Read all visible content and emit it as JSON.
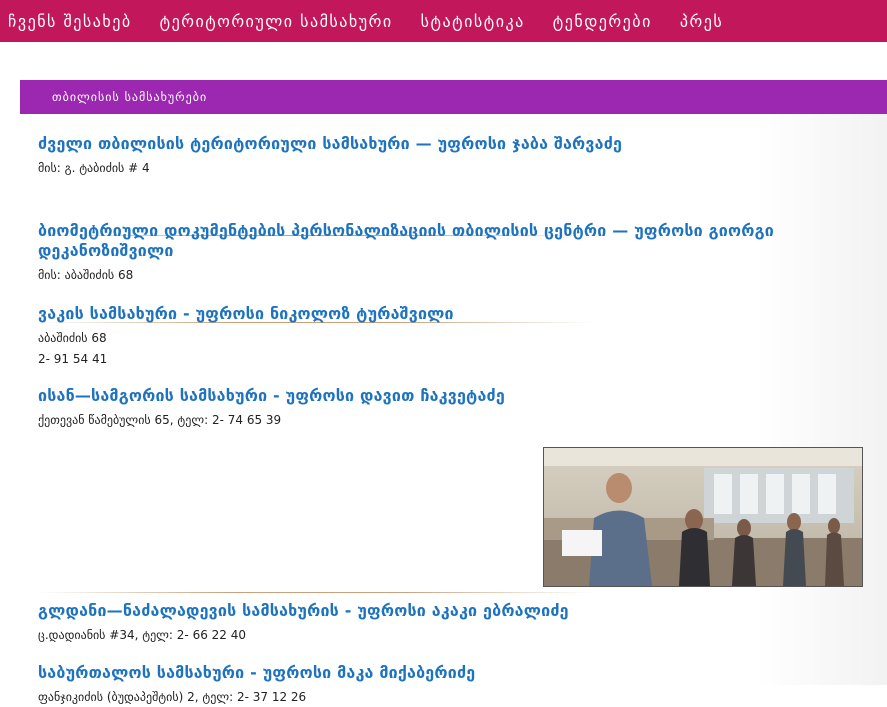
{
  "nav": {
    "items": [
      "ჩვენს შესახებ",
      "ტერიტორიული სამსახური",
      "სტატისტიკა",
      "ტენდერები",
      "პრეს"
    ]
  },
  "panel": {
    "heading": "თბილისის სამსახურები",
    "entries": [
      {
        "title": "ძველი თბილისის ტერიტორიული სამსახური — უფროსი ჯაბა შარვაძე",
        "lines": [
          "მის: გ. ტაბიძის # 4"
        ]
      },
      {
        "title": "ბიომეტრიული დოკუმენტების პერსონალიზაციის თბილისის ცენტრი — უფროსი გიორგი დეკანოზიშვილი",
        "lines": [
          "მის: აბაშიძის 68"
        ]
      },
      {
        "title": "ვაკის სამსახური - უფროსი ნიკოლოზ ტურაშვილი",
        "lines": [
          "აბაშიძის 68",
          "2- 91 54 41"
        ]
      },
      {
        "title": "ისან—სამგორის სამსახური - უფროსი დავით ჩაკვეტაძე",
        "lines": [
          "ქეთევან წამებულის 65, ტელ: 2- 74 65 39"
        ]
      },
      {
        "title": "გლდანი—ნაძალადევის სამსახურის - უფროსი აკაკი ებრალიძე",
        "lines": [
          "ც.დადიანის #34, ტელ: 2- 66 22 40"
        ]
      },
      {
        "title": "საბურთალოს სამსახური - უფროსი მაკა მიქაბერიძე",
        "lines": [
          "ფანჯიკიძის (ბუდაპეშტის) 2, ტელ: 2- 37 12 26"
        ]
      }
    ]
  },
  "colors": {
    "nav_bg": "#c2185b",
    "heading_bg": "#9c27b0",
    "link": "#1e73be"
  }
}
